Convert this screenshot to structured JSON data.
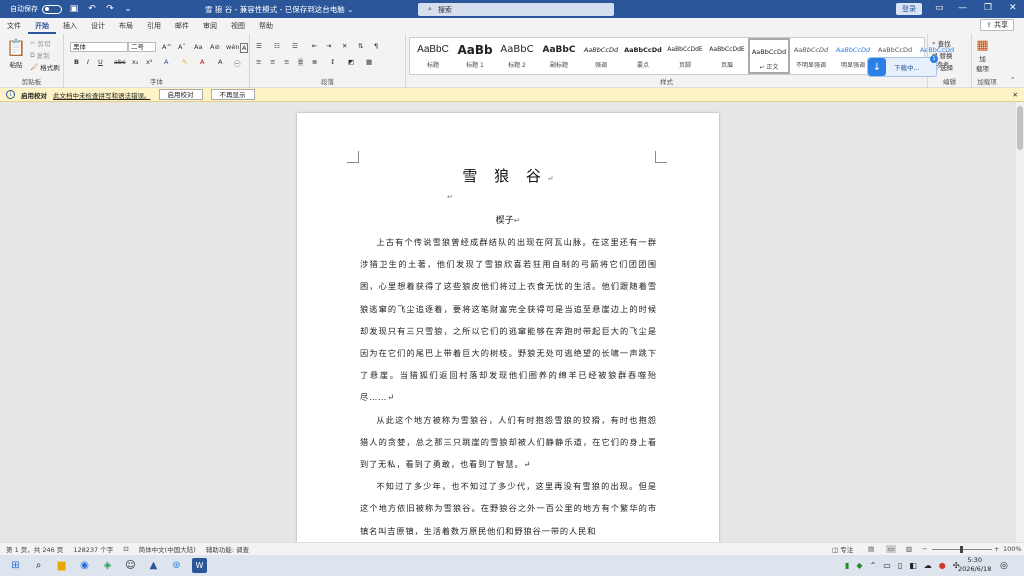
{
  "titlebar": {
    "autosave_label": "自动保存",
    "autosave_state": "关",
    "doc_title": "雪 狼 谷  -  兼容性模式  -  已保存到这台电脑 ⌄",
    "search_placeholder": "搜索",
    "login_label": "登录"
  },
  "menu": {
    "tabs": [
      "文件",
      "开始",
      "插入",
      "设计",
      "布局",
      "引用",
      "邮件",
      "审阅",
      "视图",
      "帮助"
    ],
    "active": "开始",
    "share_label": "共享"
  },
  "ribbon": {
    "clipboard": {
      "paste": "粘贴",
      "cut": "剪切",
      "copy": "复制",
      "format_painter": "格式刷",
      "label": "剪贴板"
    },
    "font": {
      "font_name": "黑体",
      "font_size": "二号",
      "label": "字体",
      "bold": "B",
      "italic": "I",
      "underline": "U",
      "strike": "abc",
      "sub": "x₂",
      "sup": "x²",
      "aa": "Aa",
      "grow": "A^",
      "shrink": "Aˇ",
      "clear": "A⊘",
      "wen": "wén",
      "ab": "A"
    },
    "paragraph": {
      "label": "段落"
    },
    "styles": {
      "label": "样式",
      "items": [
        {
          "preview": "AaBbC",
          "name": "标题"
        },
        {
          "preview": "AaBb",
          "name": "标题 1"
        },
        {
          "preview": "AaBbC",
          "name": "标题 2"
        },
        {
          "preview": "AaBbC",
          "name": "副标题"
        },
        {
          "preview": "AaBbCcDd",
          "name": "强调"
        },
        {
          "preview": "AaBbCcDd",
          "name": "要点"
        },
        {
          "preview": "AaBbCcDdE",
          "name": "页脚"
        },
        {
          "preview": "AaBbCcDdE",
          "name": "页眉"
        },
        {
          "preview": "AaBbCcDd",
          "name": "↵ 正文"
        },
        {
          "preview": "AaBbCcDd",
          "name": "不明显强调"
        },
        {
          "preview": "AaBbCcDd",
          "name": "明显强调"
        },
        {
          "preview": "AaBbCcDd",
          "name": "不明显参考"
        },
        {
          "preview": "AaBbCcDd",
          "name": "明显参考"
        }
      ]
    },
    "editing": {
      "find": "查找",
      "replace": "替换",
      "select": "选择",
      "label": "编辑"
    },
    "addins": {
      "add": "加",
      "items": "载项",
      "label": "加载项"
    },
    "download_popup": "下载中..."
  },
  "notice": {
    "title": "启用校对",
    "message": "此文档中未检查拼写和语法错误。",
    "enable_btn": "启用校对",
    "dismiss_btn": "不再显示"
  },
  "document": {
    "title": "雪 狼 谷",
    "subtitle": "楔子",
    "paragraphs": [
      "上古有个传说雪狼曾经成群结队的出现在阿瓦山脉。在这里还有一群涉猎卫生的土著，他们发现了雪狼欣喜若狂用自制的弓箭将它们团团围困，心里想着获得了这些狼皮他们将过上衣食无忧的生活。他们跟随着雪狼逃窜的飞尘追逐着，要将这笔财富完全获得可是当追至悬崖边上的时候却发现只有三只雪狼，之所以它们的逃窜能够在奔跑时带起巨大的飞尘是因为在它们的尾巴上带着巨大的树枝。野狼无处可逃绝望的长啸一声跳下了悬崖。当猎狐们返回村落却发现他们圈养的绵羊已经被狼群吞噬殆尽……↵",
      "从此这个地方被称为雪狼谷，人们有时抱怨雪狼的狡猾，有时也抱怨猎人的贪婪，总之那三只跳崖的雪狼却被人们静静乐道，在它们的身上看到了无私，看到了勇敢，也看到了智慧。↵",
      "不知过了多少年，也不知过了多少代，这里再没有雪狼的出现。但是这个地方依旧被称为雪狼谷。在野狼谷之外一百公里的地方有个繁华的市镇名叫吉原镇，生活着数万原民他们和野狼谷一带的人民和"
    ]
  },
  "status": {
    "page": "第 1 页，共 246 页",
    "words": "128237 个字",
    "language": "简体中文(中国大陆)",
    "accessibility": "辅助功能: 调查",
    "focus": "专注",
    "zoom": "100%"
  },
  "taskbar": {
    "time": "5:30",
    "date": "2026/6/18"
  }
}
